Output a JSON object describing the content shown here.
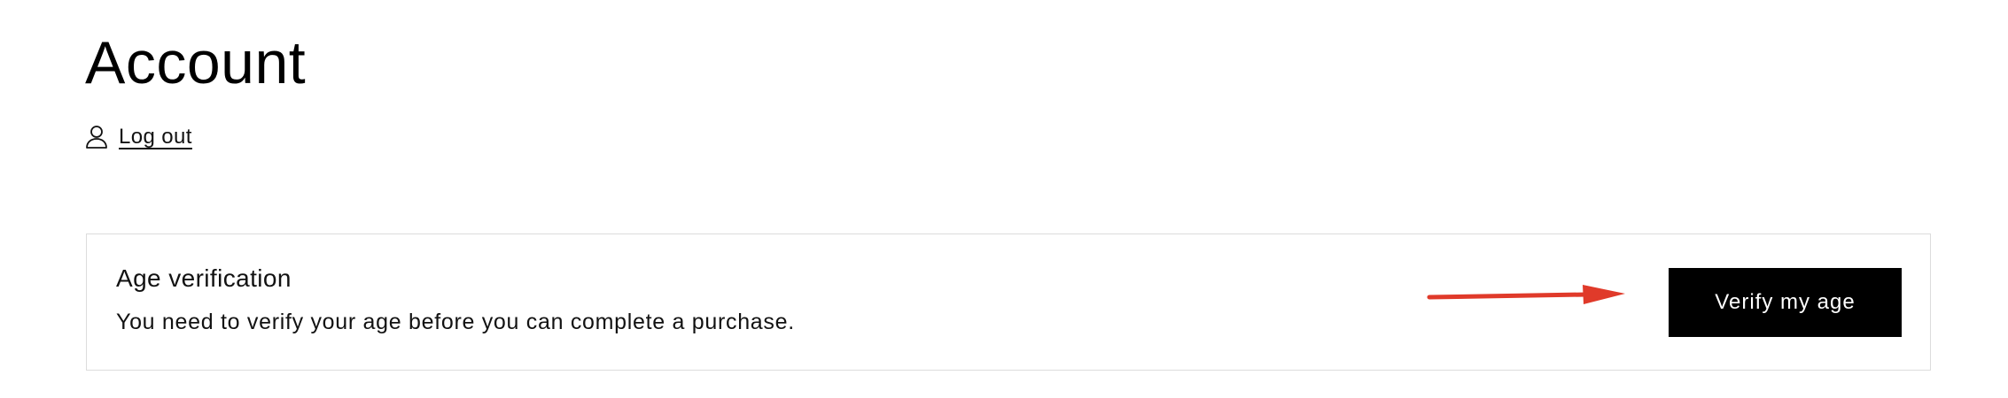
{
  "page": {
    "title": "Account"
  },
  "account_actions": {
    "logout_icon": "user-icon",
    "logout_label": "Log out"
  },
  "age_verification": {
    "title": "Age verification",
    "message": "You need to verify your age before you can complete a purchase.",
    "button_label": "Verify my age",
    "pointer_arrow_icon": "red-arrow-icon"
  },
  "colors": {
    "text": "#121212",
    "button_background": "#000000",
    "button_text": "#ffffff",
    "card_border": "#dcdcdc",
    "arrow": "#e03a2a"
  }
}
